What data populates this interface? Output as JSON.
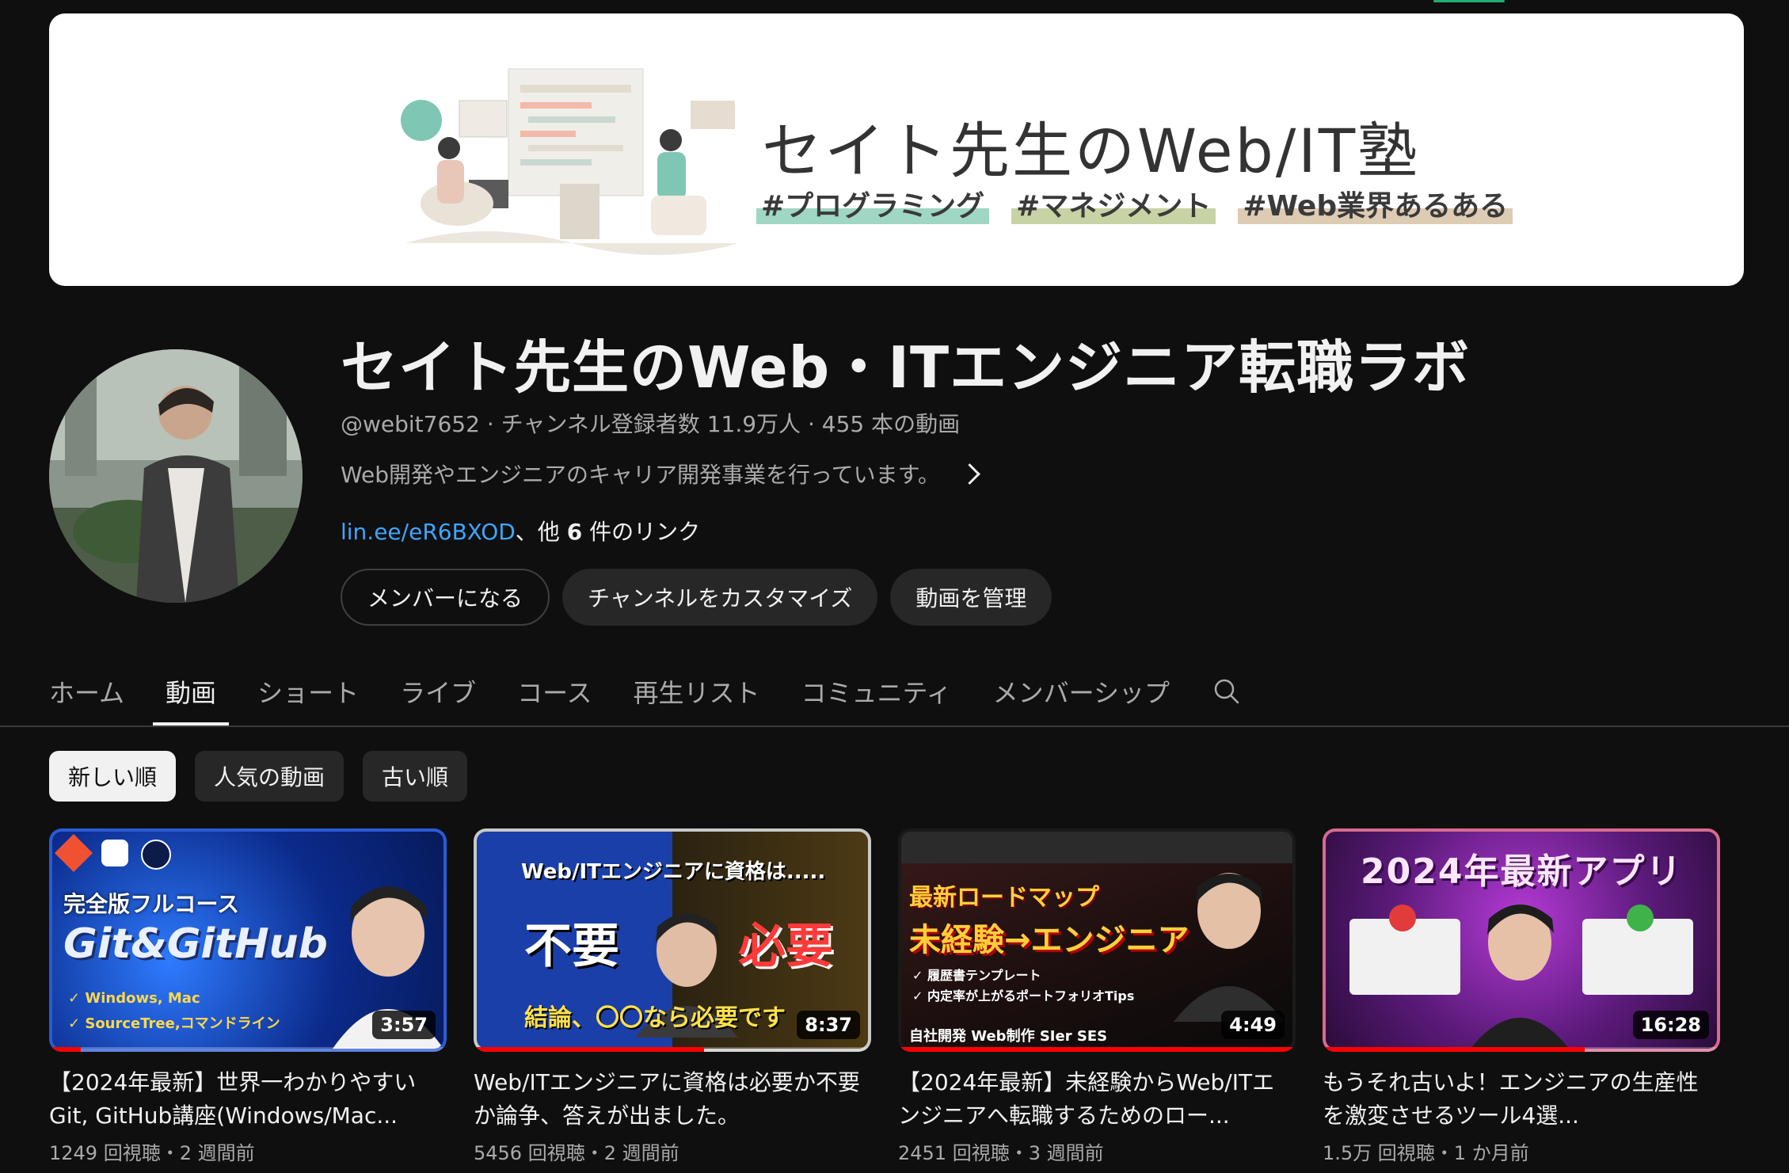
{
  "banner": {
    "title": "セイト先生のWeb/IT塾",
    "tags": [
      "#プログラミング",
      "#マネジメント",
      "#Web業界あるある"
    ]
  },
  "channel": {
    "name": "セイト先生のWeb・ITエンジニア転職ラボ",
    "handle": "@webit7652",
    "subscribers": "チャンネル登録者数 11.9万人",
    "video_count": "455 本の動画",
    "description": "Web開発やエンジニアのキャリア開発事業を行っています。",
    "link": "lin.ee/eR6BXOD",
    "link_suffix_pre": "、他 ",
    "link_count": "6",
    "link_suffix_post": " 件のリンク"
  },
  "actions": {
    "member": "メンバーになる",
    "customize": "チャンネルをカスタマイズ",
    "manage": "動画を管理"
  },
  "tabs": [
    {
      "label": "ホーム",
      "active": false
    },
    {
      "label": "動画",
      "active": true
    },
    {
      "label": "ショート",
      "active": false
    },
    {
      "label": "ライブ",
      "active": false
    },
    {
      "label": "コース",
      "active": false
    },
    {
      "label": "再生リスト",
      "active": false
    },
    {
      "label": "コミュニティ",
      "active": false
    },
    {
      "label": "メンバーシップ",
      "active": false
    }
  ],
  "filters": [
    {
      "label": "新しい順",
      "active": true
    },
    {
      "label": "人気の動画",
      "active": false
    },
    {
      "label": "古い順",
      "active": false
    }
  ],
  "videos": [
    {
      "title": "【2024年最新】世界一わかりやすいGit, GitHub講座(Windows/Mac...",
      "meta": "1249 回視聴・2 週間前",
      "duration": "3:57",
      "progress": 0.08,
      "thumb_text": [
        "完全版フルコース",
        "Git&GitHub",
        "✓ Windows, Mac",
        "✓ SourceTree,コマンドライン"
      ]
    },
    {
      "title": "Web/ITエンジニアに資格は必要か不要か論争、答えが出ました。",
      "meta": "5456 回視聴・2 週間前",
      "duration": "8:37",
      "progress": 0.58,
      "thumb_text": [
        "Web/ITエンジニアに資格は.....",
        "不要",
        "必要",
        "結論、〇〇なら必要です"
      ]
    },
    {
      "title": "【2024年最新】未経験からWeb/ITエンジニアへ転職するためのロー...",
      "meta": "2451 回視聴・3 週間前",
      "duration": "4:49",
      "progress": 1.0,
      "thumb_text": [
        "最新ロードマップ",
        "未経験→エンジニア",
        "✓ 履歴書テンプレート",
        "✓ 内定率が上がるポートフォリオTips",
        "自社開発 Web制作 SIer SES"
      ]
    },
    {
      "title": "もうそれ古いよ！エンジニアの生産性を激変させるツール4選...",
      "meta": "1.5万 回視聴・1 か月前",
      "duration": "16:28",
      "progress": 0.66,
      "thumb_text": [
        "2024年最新アプリ"
      ]
    }
  ],
  "colors": {
    "background": "#0f0f0f",
    "text": "#f1f1f1",
    "muted": "#aaaaaa",
    "link": "#3ea6ff",
    "chip": "#272727",
    "progress": "#ff0000"
  }
}
